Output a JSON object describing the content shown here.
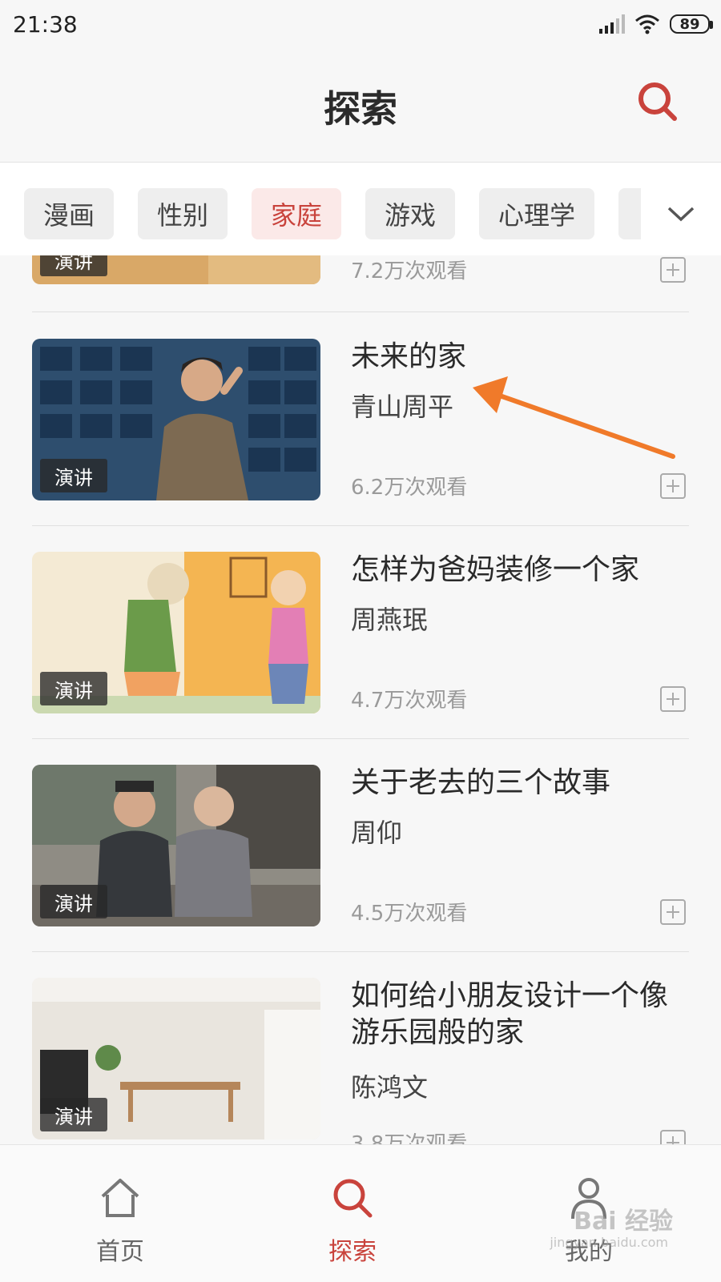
{
  "status_bar": {
    "time": "21:38",
    "battery": "89"
  },
  "header": {
    "title": "探索",
    "search_icon": "search-icon"
  },
  "tabs": [
    {
      "label": "漫画",
      "active": false
    },
    {
      "label": "性别",
      "active": false
    },
    {
      "label": "家庭",
      "active": true
    },
    {
      "label": "游戏",
      "active": false
    },
    {
      "label": "心理学",
      "active": false
    }
  ],
  "tabs_more_icon": "chevron-down-icon",
  "feed": {
    "partial_top": {
      "badge": "演讲",
      "views": "7.2万次观看"
    },
    "items": [
      {
        "badge": "演讲",
        "title": "未来的家",
        "author": "青山周平",
        "views": "6.2万次观看"
      },
      {
        "badge": "演讲",
        "title": "怎样为爸妈装修一个家",
        "author": "周燕珉",
        "views": "4.7万次观看"
      },
      {
        "badge": "演讲",
        "title": "关于老去的三个故事",
        "author": "周仰",
        "views": "4.5万次观看"
      },
      {
        "badge": "演讲",
        "title": "如何给小朋友设计一个像游乐园般的家",
        "author": "陈鸿文",
        "views": "3.8万次观看"
      }
    ]
  },
  "bottom_nav": [
    {
      "label": "首页",
      "icon": "home-icon",
      "active": false
    },
    {
      "label": "探索",
      "icon": "search-icon",
      "active": true
    },
    {
      "label": "我的",
      "icon": "user-icon",
      "active": false
    }
  ],
  "watermark": {
    "text": "Bai 经验",
    "sub": "jingyan.baidu.com"
  },
  "colors": {
    "accent": "#c9433c",
    "arrow": "#f07a2a"
  }
}
